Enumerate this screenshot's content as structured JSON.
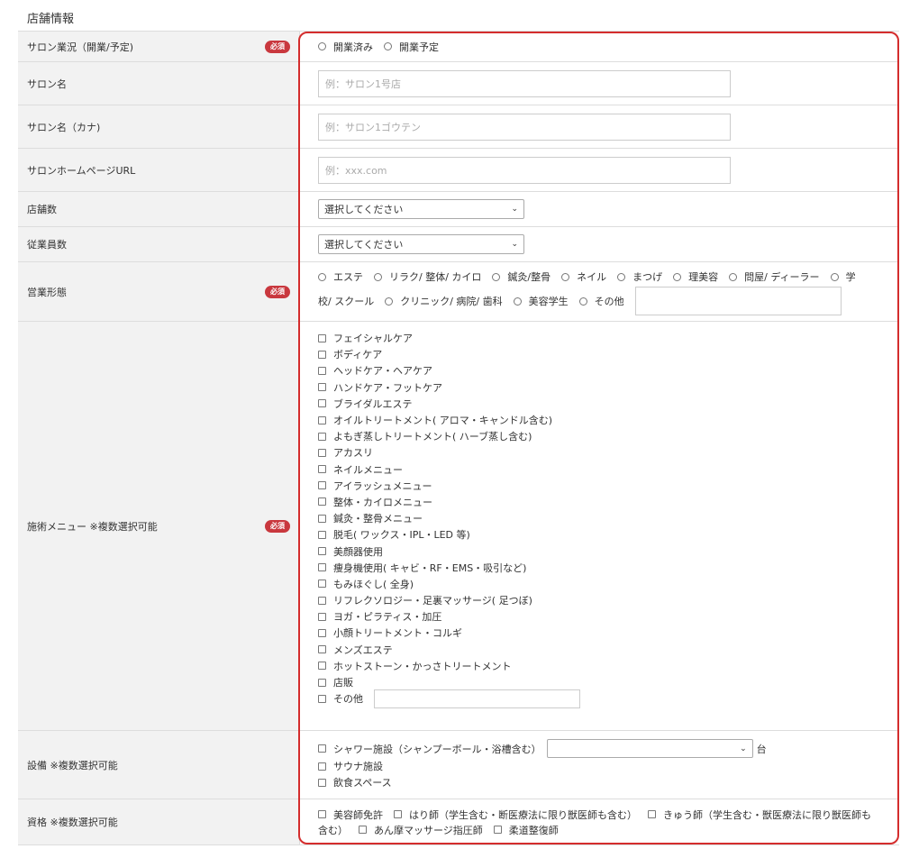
{
  "section_title": "店舗情報",
  "required_badge": "必須",
  "rows": {
    "status": {
      "label": "サロン業況（開業/予定)",
      "options": [
        "開業済み",
        "開業予定"
      ]
    },
    "salon_name": {
      "label": "サロン名",
      "placeholder": "例：サロン1号店"
    },
    "salon_kana": {
      "label": "サロン名（カナ)",
      "placeholder": "例：サロン1ゴウテン"
    },
    "homepage": {
      "label": "サロンホームページURL",
      "placeholder": "例：xxx.com"
    },
    "stores": {
      "label": "店舗数",
      "selected": "選択してください"
    },
    "employees": {
      "label": "従業員数",
      "selected": "選択してください"
    },
    "business_type": {
      "label": "営業形態",
      "line1": [
        "エステ",
        "リラク/ 整体/ カイロ",
        "鍼灸/整骨",
        "ネイル",
        "まつげ",
        "理美容",
        "問屋/ ディーラー",
        "学"
      ],
      "line2_prefix": "校/ スクール",
      "line2": [
        "クリニック/ 病院/ 歯科",
        "美容学生",
        "その他"
      ]
    },
    "menu": {
      "label": "施術メニュー ※複数選択可能",
      "items": [
        "フェイシャルケア",
        "ボディケア",
        "ヘッドケア・ヘアケア",
        "ハンドケア・フットケア",
        "ブライダルエステ",
        "オイルトリートメント( アロマ・キャンドル含む)",
        "よもぎ蒸しトリートメント( ハーブ蒸し含む)",
        "アカスリ",
        "ネイルメニュー",
        "アイラッシュメニュー",
        "整体・カイロメニュー",
        "鍼灸・整骨メニュー",
        "脱毛( ワックス・IPL・LED 等)",
        "美顔器使用",
        "痩身機使用( キャビ・RF・EMS・吸引など)",
        "もみほぐし( 全身)",
        "リフレクソロジー・足裏マッサージ( 足つぼ)",
        "ヨガ・ピラティス・加圧",
        "小顔トリートメント・コルギ",
        "メンズエステ",
        "ホットストーン・かっさトリートメント",
        "店販",
        "その他"
      ]
    },
    "facilities": {
      "label": "設備 ※複数選択可能",
      "items": [
        "シャワー施設（シャンプーボール・浴槽含む）",
        "サウナ施設",
        "飲食スペース"
      ],
      "unit": "台"
    },
    "qualifications": {
      "label": "資格 ※複数選択可能",
      "line1": [
        "美容師免許",
        "はり師（学生含む・断医療法に限り獣医師も含む）",
        "きゅう師（学生含む・獣医療法に限り獣医師も"
      ],
      "line2_prefix": "含む）",
      "line2": [
        "あん摩マッサージ指圧師",
        "柔道整復師"
      ]
    }
  }
}
